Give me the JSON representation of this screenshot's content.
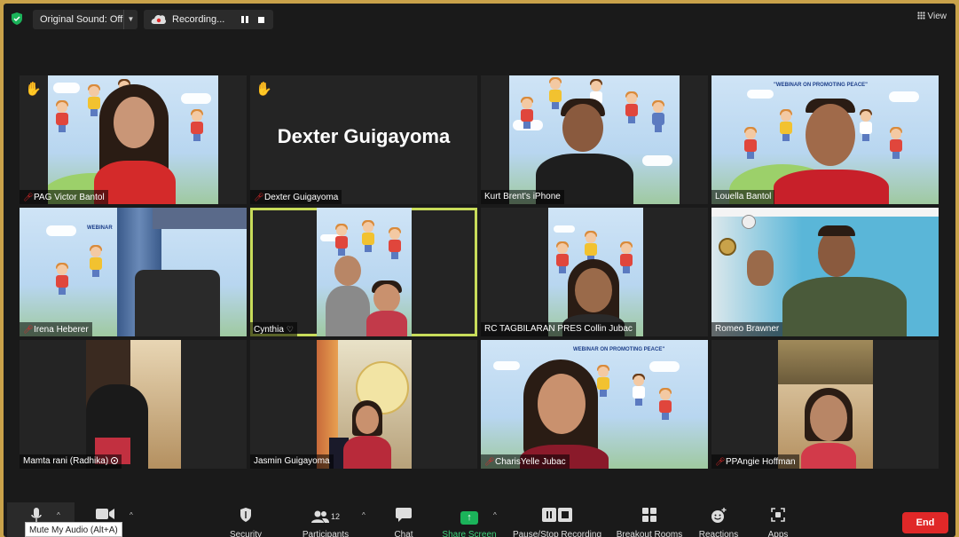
{
  "topbar": {
    "original_sound": "Original Sound: Off",
    "recording": "Recording...",
    "view": "View",
    "shield_color": "#1bb35a"
  },
  "tiles": [
    {
      "name": "PAG Victor Bantol",
      "muted": true,
      "hand_raised": true
    },
    {
      "name": "Dexter Guigayoma",
      "muted": true,
      "hand_raised": true,
      "display_name": "Dexter Guigayoma"
    },
    {
      "name": "Kurt Brent's iPhone",
      "muted": false
    },
    {
      "name": "Louella Bantol",
      "muted": false,
      "banner": "\"WEBINAR ON PROMOTING PEACE\""
    },
    {
      "name": "Irena Heberer",
      "muted": true,
      "banner": "WEBINAR"
    },
    {
      "name": "Cynthia",
      "muted": false,
      "active_speaker": true
    },
    {
      "name": "RC TAGBILARAN PRES Collin Jubac",
      "muted": false
    },
    {
      "name": "Romeo Brawner",
      "muted": false
    },
    {
      "name": "Mamta rani (Radhika)",
      "muted": false
    },
    {
      "name": "Jasmin Guigayoma",
      "muted": false
    },
    {
      "name": "CharisYelle Jubac",
      "muted": true,
      "banner": "WEBINAR ON PROMOTING PEACE\""
    },
    {
      "name": "PPAngie Hoffman",
      "muted": true
    }
  ],
  "toolbar": {
    "security": "Security",
    "participants": "Participants",
    "participants_count": "12",
    "chat": "Chat",
    "share_screen": "Share Screen",
    "pause_stop": "Pause/Stop Recording",
    "breakout": "Breakout Rooms",
    "reactions": "Reactions",
    "apps": "Apps",
    "end": "End",
    "mute_tooltip": "Mute My Audio (Alt+A)",
    "share_color": "#1bb35a",
    "end_color": "#e02828"
  }
}
